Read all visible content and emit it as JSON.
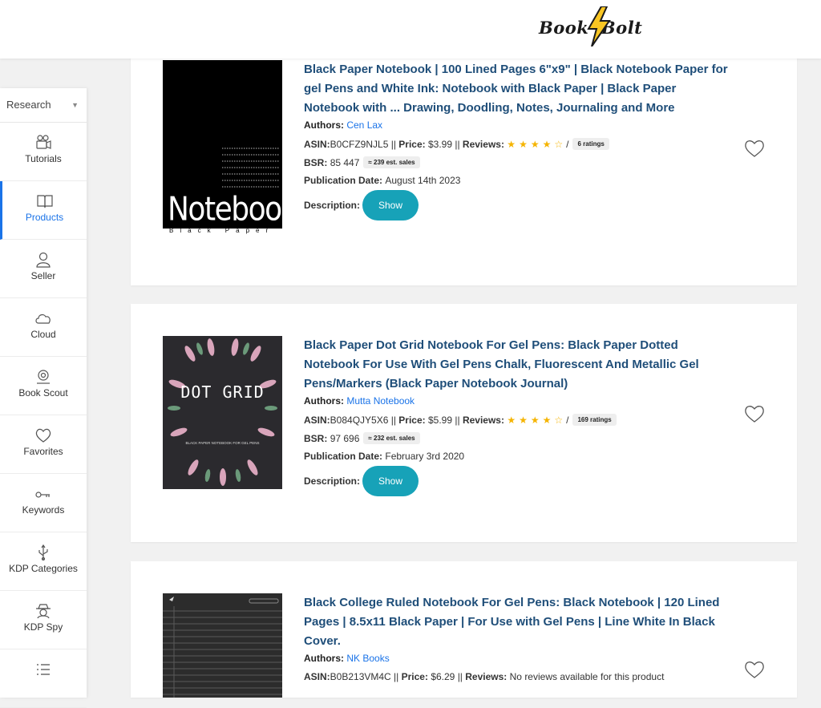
{
  "brand": {
    "logo_text": "Book Bolt"
  },
  "sidebar": {
    "selector": "Research",
    "items": [
      {
        "label": "Tutorials",
        "icon": "video-camera-icon",
        "active": false
      },
      {
        "label": "Products",
        "icon": "open-book-icon",
        "active": true
      },
      {
        "label": "Seller",
        "icon": "user-icon",
        "active": false
      },
      {
        "label": "Cloud",
        "icon": "cloud-icon",
        "active": false
      },
      {
        "label": "Book Scout",
        "icon": "scout-icon",
        "active": false
      },
      {
        "label": "Favorites",
        "icon": "heart-icon",
        "active": false
      },
      {
        "label": "Keywords",
        "icon": "key-icon",
        "active": false
      },
      {
        "label": "KDP Categories",
        "icon": "usb-icon",
        "active": false
      },
      {
        "label": "KDP Spy",
        "icon": "spy-icon",
        "active": false
      },
      {
        "label": "",
        "icon": "list-icon",
        "active": false
      }
    ]
  },
  "labels": {
    "authors": "Authors:",
    "asin": "ASIN:",
    "price": "Price:",
    "reviews": "Reviews:",
    "bsr": "BSR:",
    "pub_date": "Publication Date:",
    "description": "Description:",
    "show": "Show"
  },
  "products": [
    {
      "title": "Black Paper Notebook | 100 Lined Pages 6\"x9\" | Black Notebook Paper for gel Pens and White Ink: Notebook with Black Paper | Black Paper Notebook with ... Drawing, Doodling, Notes, Journaling and More",
      "author": "Cen Lax",
      "asin": "B0CFZ9NJL5",
      "price": "$3.99",
      "rating_stars": 4,
      "ratings_text": "6 ratings",
      "bsr": "85 447",
      "est_sales": "≈ 239 est. sales",
      "pub_date": "August 14th 2023",
      "cover": {
        "title": "Notebook",
        "subtitle": "Black Paper"
      }
    },
    {
      "title": "Black Paper Dot Grid Notebook For Gel Pens: Black Paper Dotted Notebook For Use With Gel Pens Chalk, Fluorescent And Metallic Gel Pens/Markers (Black Paper Notebook Journal)",
      "author": "Mutta Notebook",
      "asin": "B084QJY5X6",
      "price": "$5.99",
      "rating_stars": 4,
      "ratings_text": "169 ratings",
      "bsr": "97 696",
      "est_sales": "≈ 232 est. sales",
      "pub_date": "February 3rd 2020",
      "cover": {
        "title": "DOT GRID",
        "subtitle": "BLACK PAPER NOTEBOOK FOR GEL PENS"
      }
    },
    {
      "title": "Black College Ruled Notebook For Gel Pens: Black Notebook | 120 Lined Pages | 8.5x11 Black Paper | For Use with Gel Pens | Line White In Black Cover.",
      "author": "NK Books",
      "asin": "B0B213VM4C",
      "price": "$6.29",
      "reviews_text": "No reviews available for this product"
    }
  ]
}
